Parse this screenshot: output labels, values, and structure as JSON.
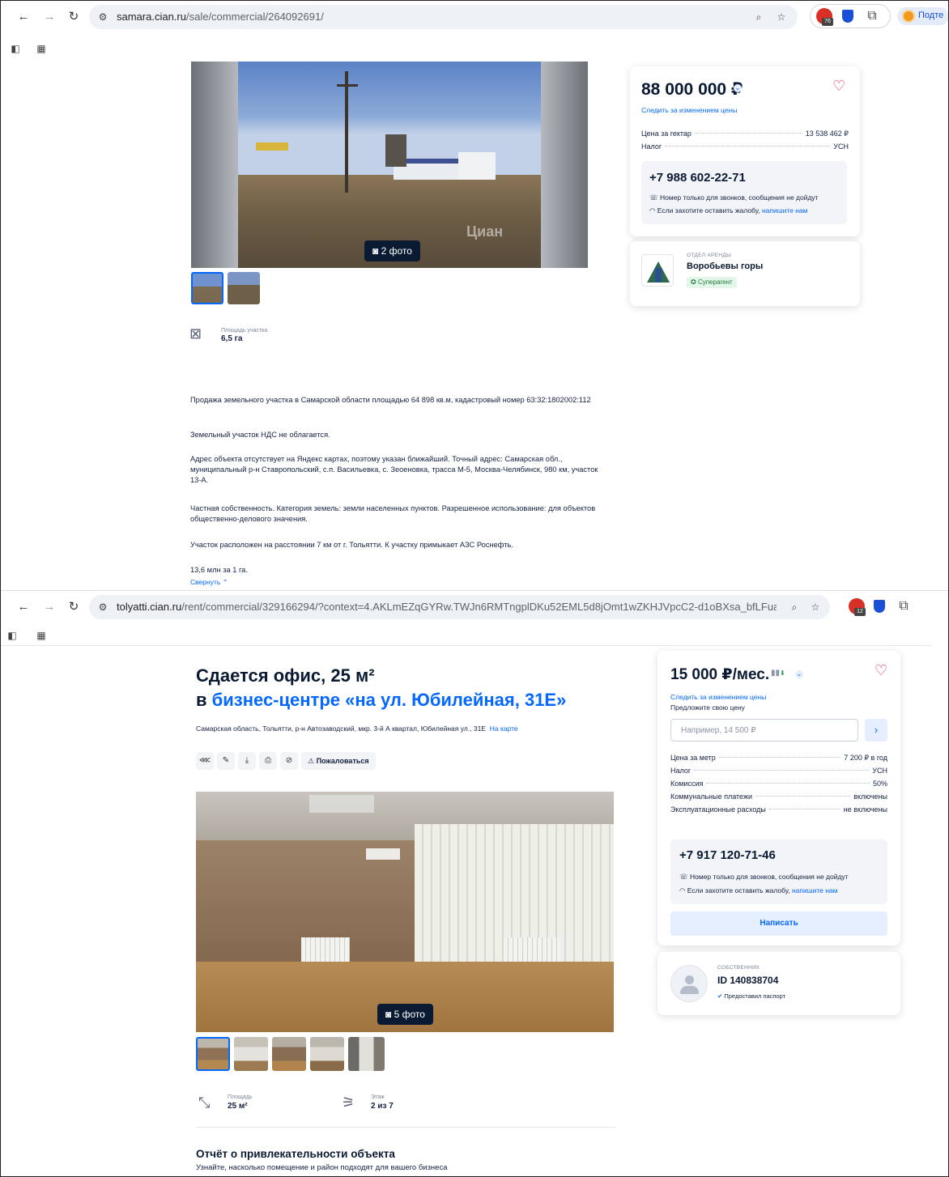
{
  "window1": {
    "url_host": "samara.cian.ru",
    "url_path": "/sale/commercial/264092691/",
    "profile_label": "Подте",
    "ext_badge": "76"
  },
  "listing1": {
    "photo_count": "2 фото",
    "watermark": "Циан",
    "price": "88 000 000 ₽",
    "follow_price": "Следить за изменением цены",
    "price_rows": [
      {
        "label": "Цена за гектар",
        "value": "13 538 462 ₽"
      },
      {
        "label": "Налог",
        "value": "УСН"
      }
    ],
    "phone": "+7 988 602-22-71",
    "phone_note": "Номер только для звонков, сообщения не дойдут",
    "complaint_prefix": "Если захотите оставить жалобу,",
    "complaint_link": "напишите нам",
    "agency_type": "ОТДЕЛ АРЕНДЫ",
    "agency_name": "Воробьевы горы",
    "agency_badge": "Суперагент",
    "area_label": "Площадь участка",
    "area_value": "6,5 га",
    "description": [
      "Продажа земельного участка в Самарской области площадью 64 898 кв.м, кадастровый номер 63:32:1802002:112",
      "Земельный участок НДС не облагается.",
      "Адрес объекта отсутствует на Яндекс картах, поэтому указан ближайший. Точный адрес: Самарская обл., муниципальный р-н Ставропольский, с.п. Васильевка, с. Зеоеновка, трасса М-5, Москва-Челябинск, 980 км, участок  13-А.",
      "Частная собственность. Категория земель: земли населенных пунктов. Разрешенное использование: для объектов общественно-делового значения.",
      "Участок расположен на расстоянии 7 км от г. Тольятти. К участку примыкает АЗС Роснефть.",
      "13,6 млн за 1 га."
    ],
    "collapse_label": "Свернуть"
  },
  "window2": {
    "url_host": "tolyatti.cian.ru",
    "url_path": "/rent/commercial/329166294/?context=4.AKLmEZqGYRw.TWJn6RMTngplDKu52EML5d8jOmt1wZKHJVpcC2-d1oBXsa_bfLFuaYtpaMyQu...",
    "ext_badge": "12"
  },
  "listing2": {
    "title_line1": "Сдается офис, 25 м²",
    "title_prefix": "в",
    "title_link": "бизнес-центре «на ул. Юбилейная, 31Е»",
    "address": "Самарская область, Тольятти, р-н Автозаводский, мкр. 3-й А квартал, Юбилейная ул., 31Е",
    "map_link": "На карте",
    "complain_btn": "Пожаловаться",
    "photo_count": "5 фото",
    "price": "15 000 ₽/мес.",
    "follow_price": "Следить за изменением цены",
    "offer_label": "Предложите свою цену",
    "offer_placeholder": "Например, 14 500 ₽",
    "price_rows": [
      {
        "label": "Цена за метр",
        "value": "7 200 ₽ в год"
      },
      {
        "label": "Налог",
        "value": "УСН"
      },
      {
        "label": "Комиссия",
        "value": "50%"
      },
      {
        "label": "Коммунальные платежи",
        "value": "включены"
      },
      {
        "label": "Эксплуатационные расходы",
        "value": "не включены"
      }
    ],
    "phone": "+7 917 120-71-46",
    "phone_note": "Номер только для звонков, сообщения не дойдут",
    "complaint_prefix": "Если захотите оставить жалобу,",
    "complaint_link": "напишите нам",
    "write_btn": "Написать",
    "owner_type": "СОБСТВЕННИК",
    "owner_id": "ID 140838704",
    "owner_badge": "Предоставил паспорт",
    "area_label": "Площадь",
    "area_value": "25 м²",
    "floor_label": "Этаж",
    "floor_value": "2 из 7",
    "report_title": "Отчёт о привлекательности объекта",
    "report_sub": "Узнайте, насколько помещение и район подходят для вашего бизнеса"
  },
  "colors": {
    "accent": "#0468ff",
    "heart": "#e0254a",
    "dark": "#0b1a33"
  }
}
